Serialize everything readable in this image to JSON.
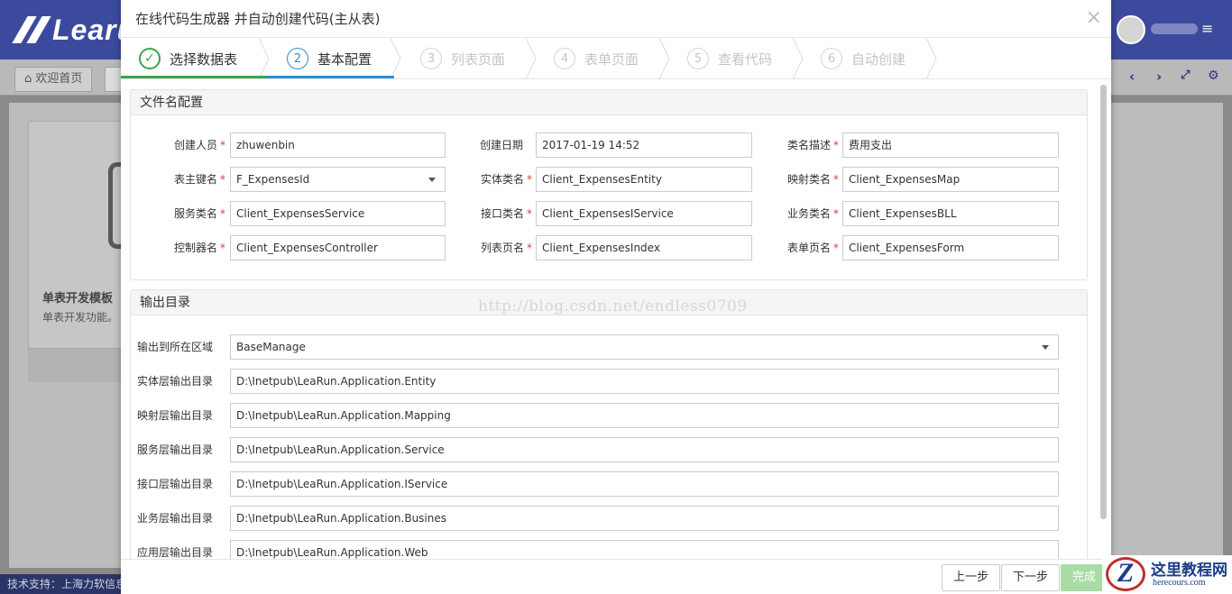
{
  "background_app": {
    "logo_text": "Learu",
    "tabs": {
      "home_label": "欢迎首页"
    },
    "card": {
      "title": "单表开发模板",
      "description": "单表开发功能。"
    },
    "footer_text": "技术支持：上海力软信息"
  },
  "modal": {
    "title": "在线代码生成器 并自动创建代码(主从表)",
    "close_glyph": "×",
    "steps": [
      {
        "num": "✓",
        "label": "选择数据表",
        "state": "done"
      },
      {
        "num": "2",
        "label": "基本配置",
        "state": "active"
      },
      {
        "num": "3",
        "label": "列表页面",
        "state": "pending"
      },
      {
        "num": "4",
        "label": "表单页面",
        "state": "pending"
      },
      {
        "num": "5",
        "label": "查看代码",
        "state": "pending"
      },
      {
        "num": "6",
        "label": "自动创建",
        "state": "pending"
      }
    ],
    "file_config": {
      "heading": "文件名配置",
      "fields": [
        {
          "label": "创建人员",
          "required": true,
          "value": "zhuwenbin"
        },
        {
          "label": "创建日期",
          "required": false,
          "value": "2017-01-19 14:52"
        },
        {
          "label": "类名描述",
          "required": true,
          "value": "费用支出"
        },
        {
          "label": "表主键名",
          "required": true,
          "value": "F_ExpensesId",
          "dropdown": true
        },
        {
          "label": "实体类名",
          "required": true,
          "value": "Client_ExpensesEntity"
        },
        {
          "label": "映射类名",
          "required": true,
          "value": "Client_ExpensesMap"
        },
        {
          "label": "服务类名",
          "required": true,
          "value": "Client_ExpensesService"
        },
        {
          "label": "接口类名",
          "required": true,
          "value": "Client_ExpensesIService"
        },
        {
          "label": "业务类名",
          "required": true,
          "value": "Client_ExpensesBLL"
        },
        {
          "label": "控制器名",
          "required": true,
          "value": "Client_ExpensesController"
        },
        {
          "label": "列表页名",
          "required": true,
          "value": "Client_ExpensesIndex"
        },
        {
          "label": "表单页名",
          "required": true,
          "value": "Client_ExpensesForm"
        }
      ]
    },
    "output_dir": {
      "heading": "输出目录",
      "fields": [
        {
          "label": "输出到所在区域",
          "value": "BaseManage",
          "dropdown": true
        },
        {
          "label": "实体层输出目录",
          "value": "D:\\Inetpub\\LeaRun.Application.Entity"
        },
        {
          "label": "映射层输出目录",
          "value": "D:\\Inetpub\\LeaRun.Application.Mapping"
        },
        {
          "label": "服务层输出目录",
          "value": "D:\\Inetpub\\LeaRun.Application.Service"
        },
        {
          "label": "接口层输出目录",
          "value": "D:\\Inetpub\\LeaRun.Application.IService"
        },
        {
          "label": "业务层输出目录",
          "value": "D:\\Inetpub\\LeaRun.Application.Busines"
        },
        {
          "label": "应用层输出目录",
          "value": "D:\\Inetpub\\LeaRun.Application.Web"
        }
      ]
    },
    "watermark": "http://blog.csdn.net/endless0709",
    "buttons": {
      "prev": "上一步",
      "next": "下一步",
      "finish": "完成"
    }
  },
  "site_logo": {
    "mark": "Z",
    "title": "这里教程网",
    "url": "herecours.com"
  },
  "colors": {
    "header": "#3c4a9e",
    "done": "#3aa44a",
    "active": "#2b8fd8",
    "required": "#e03a3a"
  }
}
